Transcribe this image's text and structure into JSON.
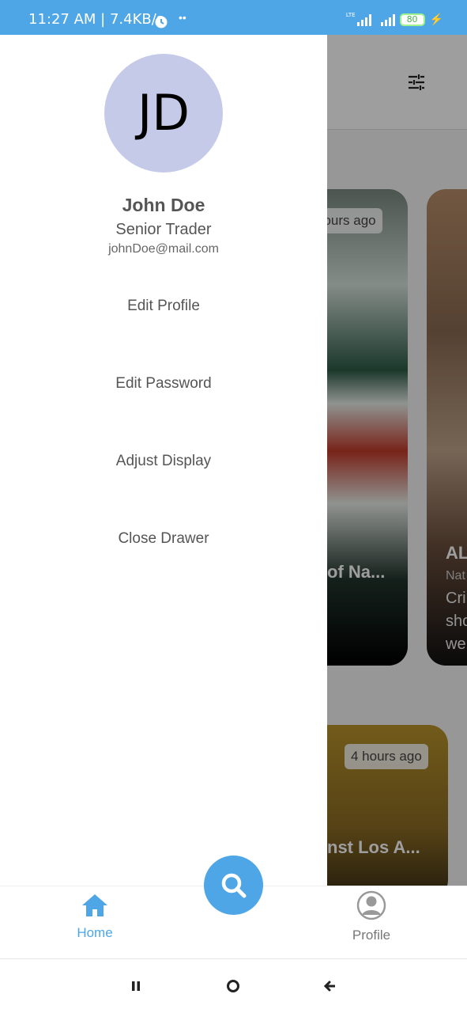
{
  "status_bar": {
    "time_speed": "11:27 AM | 7.4KB/s",
    "dots": "••",
    "network": "LTE",
    "battery": "80"
  },
  "background": {
    "cards": [
      {
        "time": "hours ago",
        "title": "of Na..."
      },
      {
        "time": "4 hours ago",
        "title": "nst Los A..."
      }
    ],
    "partial_card": {
      "line1": "AL",
      "line2": "Nat",
      "line3": "Cri",
      "line4": "sho",
      "line5": "we"
    }
  },
  "drawer": {
    "avatar_initials": "JD",
    "name": "John Doe",
    "role": "Senior Trader",
    "email": "johnDoe@mail.com",
    "menu": [
      {
        "label": "Edit Profile"
      },
      {
        "label": "Edit Password"
      },
      {
        "label": "Adjust Display"
      },
      {
        "label": "Close Drawer"
      }
    ]
  },
  "bottom_nav": {
    "home_label": "Home",
    "profile_label": "Profile"
  },
  "colors": {
    "accent": "#4ea6e6",
    "avatar_bg": "#c5cae9"
  },
  "icons": [
    "alarm-icon",
    "signal-icon",
    "battery-icon",
    "filter-icon",
    "search-icon",
    "home-icon",
    "profile-icon",
    "recents-icon",
    "home-circle-icon",
    "back-icon"
  ]
}
